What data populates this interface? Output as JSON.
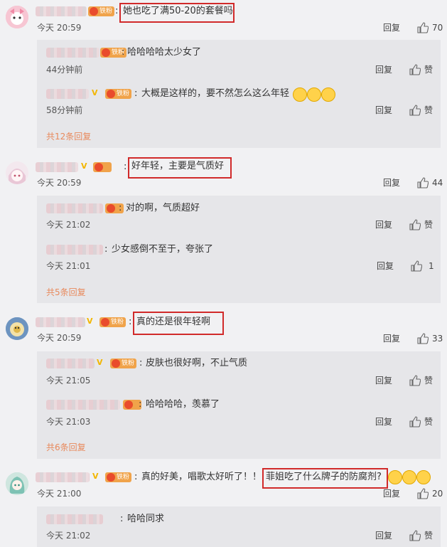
{
  "comments": [
    {
      "text": "她也吃了满50-20的套餐吗",
      "time": "今天 20:59",
      "reply_label": "回复",
      "likes": "70",
      "badge": "铁粉",
      "subs": [
        {
          "text": "哈哈哈哈太少女了",
          "time": "44分钟前",
          "reply_label": "回复",
          "like_label": "赞",
          "badge": "铁粉"
        },
        {
          "text": "大概是这样的，要不然怎么这么年轻",
          "time": "58分钟前",
          "reply_label": "回复",
          "like_label": "赞",
          "badge": "铁粉"
        }
      ],
      "more": "共12条回复"
    },
    {
      "text": "好年轻，主要是气质好",
      "time": "今天 20:59",
      "reply_label": "回复",
      "likes": "44",
      "subs": [
        {
          "text": "对的啊，气质超好",
          "time": "今天 21:02",
          "reply_label": "回复",
          "like_label": "赞"
        },
        {
          "text": "少女感倒不至于，夸张了",
          "time": "今天 21:01",
          "reply_label": "回复",
          "like_label": "1"
        }
      ],
      "more": "共5条回复"
    },
    {
      "text": "真的还是很年轻啊",
      "time": "今天 20:59",
      "reply_label": "回复",
      "likes": "33",
      "badge": "铁粉",
      "subs": [
        {
          "text": "皮肤也很好啊，不止气质",
          "time": "今天 21:05",
          "reply_label": "回复",
          "like_label": "赞",
          "badge": "铁粉"
        },
        {
          "text": "哈哈哈哈，羡慕了",
          "time": "今天 21:03",
          "reply_label": "回复",
          "like_label": "赞"
        }
      ],
      "more": "共6条回复"
    },
    {
      "text_prefix": "真的好美，唱歌太好听了！！",
      "text_highlight": "菲姐吃了什么牌子的防腐剂?",
      "time": "今天 21:00",
      "reply_label": "回复",
      "likes": "20",
      "badge": "铁粉",
      "subs": [
        {
          "text": "哈哈同求",
          "time": "今天 21:02",
          "reply_label": "回复",
          "like_label": "赞"
        }
      ]
    }
  ],
  "colors": {
    "background": "#f1f1f3",
    "sub_background": "#e6e6e9",
    "highlight_box": "#d12a2a",
    "more_link": "#e8895c"
  },
  "icons": [
    "thumb-up-icon",
    "fan-badge-icon",
    "vip-icon",
    "laugh-emoji-icon",
    "cry-emoji-icon"
  ]
}
